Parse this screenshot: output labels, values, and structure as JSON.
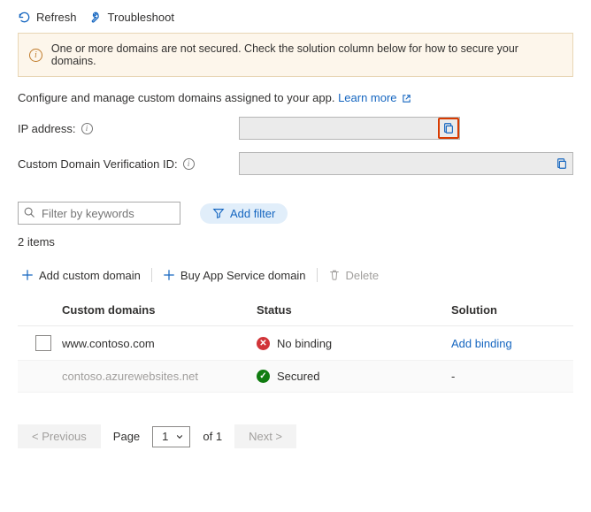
{
  "toolbar": {
    "refresh": "Refresh",
    "troubleshoot": "Troubleshoot"
  },
  "alert": {
    "text": "One or more domains are not secured. Check the solution column below for how to secure your domains."
  },
  "desc": {
    "text": "Configure and manage custom domains assigned to your app. ",
    "learn_more": "Learn more"
  },
  "fields": {
    "ip_label": "IP address:",
    "ip_value": "",
    "cdv_label": "Custom Domain Verification ID:",
    "cdv_value": ""
  },
  "filter": {
    "placeholder": "Filter by keywords",
    "add_filter": "Add filter"
  },
  "count_label": "2 items",
  "actions": {
    "add_domain": "Add custom domain",
    "buy_domain": "Buy App Service domain",
    "delete": "Delete"
  },
  "table": {
    "headers": {
      "domain": "Custom domains",
      "status": "Status",
      "solution": "Solution"
    },
    "rows": [
      {
        "domain": "www.contoso.com",
        "status": "No binding",
        "status_kind": "error",
        "solution": "Add binding",
        "solution_link": true,
        "checkable": true,
        "muted": false
      },
      {
        "domain": "contoso.azurewebsites.net",
        "status": "Secured",
        "status_kind": "ok",
        "solution": "-",
        "solution_link": false,
        "checkable": false,
        "muted": true
      }
    ]
  },
  "pager": {
    "previous": "< Previous",
    "page_word": "Page",
    "page": "1",
    "of": "of 1",
    "next": "Next >"
  }
}
